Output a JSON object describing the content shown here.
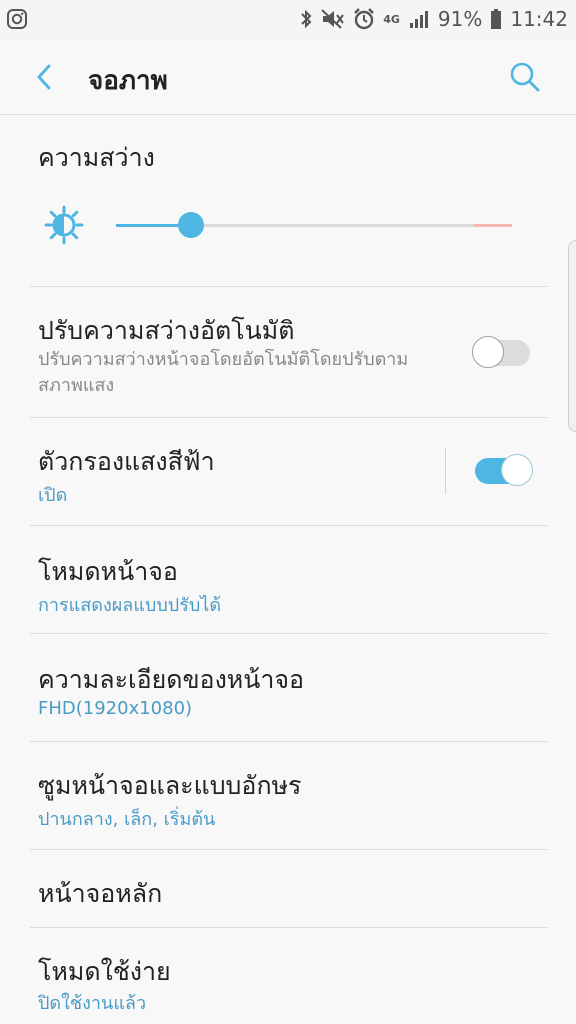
{
  "status_bar": {
    "network": "4G",
    "battery": "91%",
    "time": "11:42",
    "icons": [
      "instagram-icon",
      "bluetooth-icon",
      "mute-icon",
      "alarm-icon",
      "signal-icon",
      "battery-icon"
    ]
  },
  "header": {
    "title": "จอภาพ",
    "back_icon": "chevron-left-icon",
    "search_icon": "search-icon"
  },
  "brightness": {
    "title": "ความสว่าง",
    "icon": "brightness-icon",
    "level": 0.19
  },
  "settings": [
    {
      "title": "ปรับความสว่างอัตโนมัติ",
      "description": "ปรับความสว่างหน้าจอโดยอัตโนมัติโดยปรับตามสภาพแสง",
      "toggle": false
    },
    {
      "title": "ตัวกรองแสงสีฟ้า",
      "subtitle": "เปิด",
      "toggle": true
    },
    {
      "title": "โหมดหน้าจอ",
      "subtitle": "การแสดงผลแบบปรับได้"
    },
    {
      "title": "ความละเอียดของหน้าจอ",
      "subtitle": "FHD(1920x1080)"
    },
    {
      "title": "ซูมหน้าจอและแบบอักษร",
      "subtitle": "ปานกลาง, เล็ก, เริ่มต้น"
    },
    {
      "title": "หน้าจอหลัก"
    },
    {
      "title": "โหมดใช้ง่าย",
      "subtitle": "ปิดใช้งานแล้ว"
    }
  ],
  "colors": {
    "accent": "#4db6e3",
    "subtitle": "#4a9bc6",
    "background": "#f8f8f8"
  }
}
